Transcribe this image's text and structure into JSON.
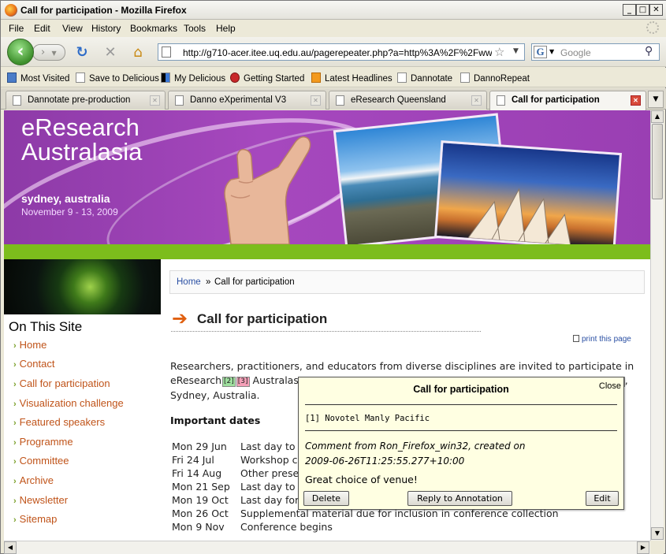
{
  "window": {
    "title": "Call for participation - Mozilla Firefox",
    "controls": {
      "minimize": "_",
      "maximize": "□",
      "close": "✕"
    }
  },
  "menu": [
    "File",
    "Edit",
    "View",
    "History",
    "Bookmarks",
    "Tools",
    "Help"
  ],
  "toolbar": {
    "url": "http://g710-acer.itee.uq.edu.au/pagerepeater.php?a=http%3A%2F%2Fwww.e",
    "search_placeholder": "Google",
    "search_engine_letter": "G"
  },
  "bookmarks": [
    "Most Visited",
    "Save to Delicious",
    "My Delicious",
    "Getting Started",
    "Latest Headlines",
    "Dannotate",
    "DannoRepeat"
  ],
  "tabs": [
    {
      "label": "Dannotate pre-production",
      "active": false
    },
    {
      "label": "Danno eXperimental V3",
      "active": false
    },
    {
      "label": "eResearch Queensland",
      "active": false
    },
    {
      "label": "Call for participation",
      "active": true
    }
  ],
  "banner": {
    "title_line1": "eResearch",
    "title_line2": "Australasia",
    "location": "sydney, australia",
    "dates": "November 9  - 13, 2009"
  },
  "sidebar": {
    "heading": "On This Site",
    "links": [
      "Home",
      "Contact",
      "Call for participation",
      "Visualization challenge",
      "Featured speakers",
      "Programme",
      "Committee",
      "Archive",
      "Newsletter",
      "Sitemap"
    ]
  },
  "breadcrumb": {
    "home": "Home",
    "separator": "»",
    "current": "Call for participation"
  },
  "page": {
    "title": "Call for participation",
    "print_link": "print this page",
    "intro_line1": "Researchers, practitioners, and educators from diverse disciplines are invited to participate in",
    "intro_line2_start": "eResearch",
    "marker_2": "[2]",
    "marker_3": "[3]",
    "intro_line2_mid": "Australas",
    "intro_line2_end": ",",
    "marker_1": "1",
    "intro_line3": "Sydney, Australia.",
    "important_heading": "Important dates",
    "dates": [
      {
        "date": "Mon 29 Jun",
        "desc": "Last day to"
      },
      {
        "date": "Fri 24 Jul",
        "desc": "Workshop c"
      },
      {
        "date": "Fri 14 Aug",
        "desc": "Other prese"
      },
      {
        "date": "Mon 21 Sep",
        "desc": "Last day to"
      },
      {
        "date": "Mon 19 Oct",
        "desc": "Last day for"
      },
      {
        "date": "Mon 26 Oct",
        "desc": "Supplemental material due for inclusion in conference collection"
      },
      {
        "date": "Mon 9 Nov",
        "desc": "Conference begins"
      }
    ]
  },
  "popup": {
    "title": "Call for participation",
    "close": "Close",
    "ref": "[1]  Novotel Manly Pacific",
    "meta_line1": "Comment from Ron_Firefox_win32, created on",
    "meta_line2": "2009-06-26T11:25:55.277+10:00",
    "comment": "Great choice of venue!",
    "delete_label": "Delete",
    "reply_label": "Reply to Annotation",
    "edit_label": "Edit"
  }
}
